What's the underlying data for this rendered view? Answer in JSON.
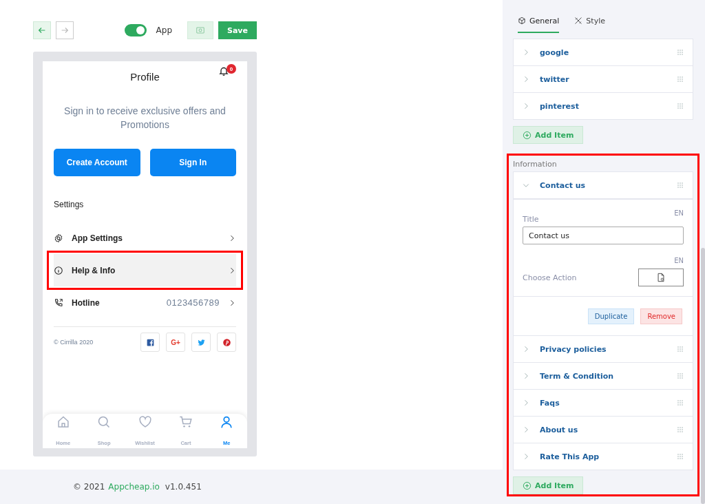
{
  "toolbar": {
    "nav": [
      {
        "kind": "back",
        "disabled": false
      },
      {
        "kind": "forward",
        "disabled": true
      }
    ],
    "toggle": {
      "label": "App",
      "on": true
    },
    "save": "Save"
  },
  "phone": {
    "title": "Profile",
    "badge": "0",
    "prompt": "Sign in to receive exclusive offers and Promotions",
    "buttons": [
      "Create Account",
      "Sign In"
    ],
    "section_title": "Settings",
    "menu": [
      {
        "kind": "gear",
        "label": "App Settings",
        "highlighted": false
      },
      {
        "kind": "info",
        "label": "Help & Info",
        "highlighted": true
      },
      {
        "kind": "phone",
        "label": "Hotline",
        "value": "0123456789",
        "highlighted": false
      }
    ],
    "copyright": "© Cirrilla 2020",
    "social": [
      {
        "kind": "facebook"
      },
      {
        "kind": "googleplus",
        "text": "G+"
      },
      {
        "kind": "twitter"
      },
      {
        "kind": "pinterest"
      }
    ],
    "tabbar": [
      {
        "kind": "home",
        "label": "Home",
        "selected": false
      },
      {
        "kind": "search",
        "label": "Shop",
        "selected": false
      },
      {
        "kind": "heart",
        "label": "Wishlist",
        "selected": false
      },
      {
        "kind": "cart",
        "label": "Cart",
        "selected": false
      },
      {
        "kind": "user",
        "label": "Me",
        "selected": true
      }
    ]
  },
  "footer": {
    "copyright": "© 2021",
    "brand": "Appcheap.io",
    "version": "v1.0.451"
  },
  "panel": {
    "tabs": [
      {
        "kind": "cube",
        "label": "General",
        "selected": true
      },
      {
        "kind": "style",
        "label": "Style",
        "selected": false
      }
    ],
    "items": [
      {
        "label": "google",
        "expanded": false
      },
      {
        "label": "twitter",
        "expanded": false
      },
      {
        "label": "pinterest",
        "expanded": false
      }
    ],
    "add_item": "Add Item",
    "section": {
      "title": "Information",
      "highlighted": true,
      "items": [
        {
          "label": "Contact us",
          "expanded": true,
          "title_label": "Title",
          "title_lang": "EN",
          "title_value": "Contact us",
          "action_label": "Choose Action",
          "action_lang": "EN",
          "duplicate": "Duplicate",
          "remove": "Remove"
        },
        {
          "label": "Privacy policies",
          "expanded": false
        },
        {
          "label": "Term & Condition",
          "expanded": false
        },
        {
          "label": "Faqs",
          "expanded": false
        },
        {
          "label": "About us",
          "expanded": false
        },
        {
          "label": "Rate This App",
          "expanded": false
        }
      ],
      "add_item": "Add Item"
    }
  }
}
